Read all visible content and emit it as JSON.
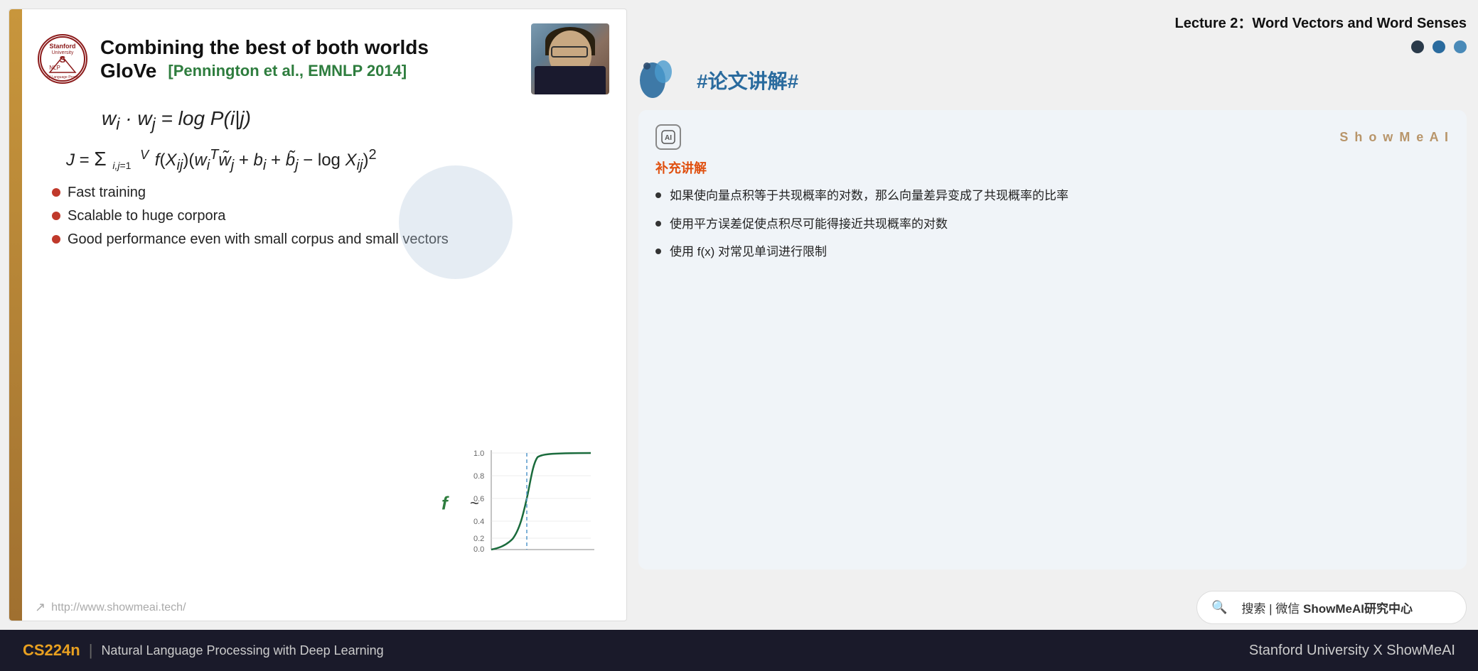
{
  "lecture": {
    "title": "Lecture 2：Word Vectors and Word Senses"
  },
  "slide": {
    "title_main": "Combining the best of both worlds",
    "title_sub": "GloVe",
    "title_ref": "[Pennington et al., EMNLP 2014]",
    "equation1": "wᵢ · wⱼ = log P(i|j)",
    "equation2": "J = Σ f(Xᵢⱼ)(wᵢᵀw̃ⱼ + bᵢ + b̃ⱼ - log Xᵢⱼ)²",
    "bullets": [
      "Fast training",
      "Scalable to huge corpora",
      "Good performance even with small corpus and small vectors"
    ],
    "footer_url": "http://www.showmeai.tech/"
  },
  "annotation": {
    "title": "#论文讲解#",
    "subtitle": "补充讲解",
    "bullets": [
      "如果使向量点积等于共现概率的对数，那么向量差异变成了共现概率的比率",
      "使用平方误差促使点积尽可能得接近共现概率的对数",
      "使用 f(x) 对常见单词进行限制"
    ]
  },
  "search": {
    "text": "搜索 | 微信 ShowMeAI研究中心"
  },
  "bottom_bar": {
    "course": "CS224n",
    "separator": "|",
    "description": "Natural Language Processing with Deep Learning",
    "right": "Stanford University  X  ShowMeAI"
  },
  "showmeai": {
    "watermark": "S h o w M e A I"
  },
  "dots": [
    {
      "color": "#2a3a4a"
    },
    {
      "color": "#2a6b9e"
    },
    {
      "color": "#4a8ab8"
    }
  ]
}
